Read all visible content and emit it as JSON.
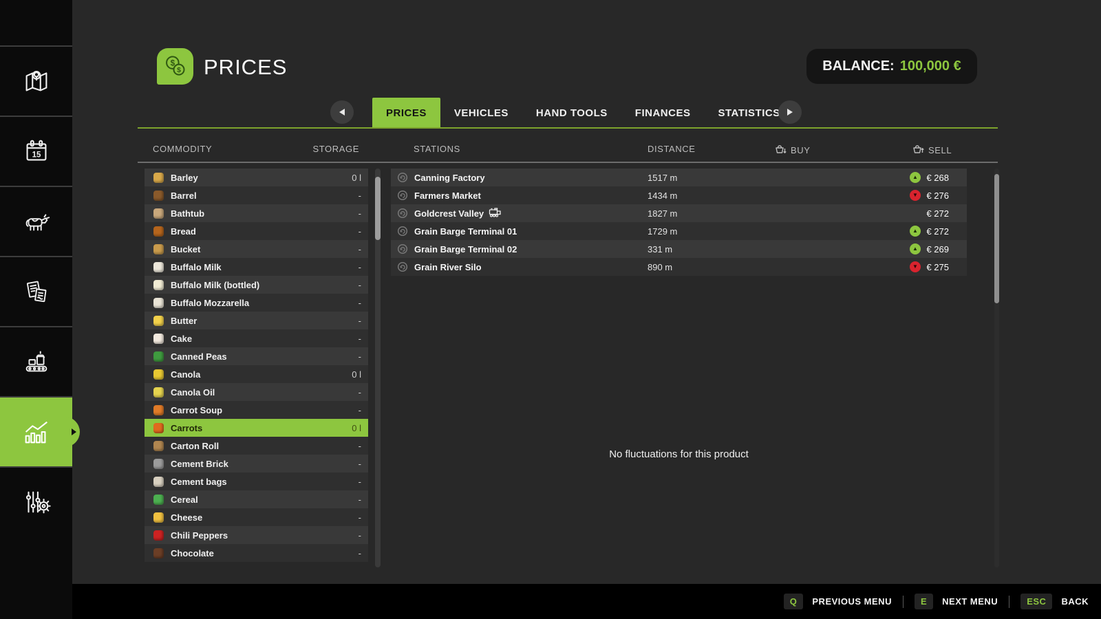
{
  "header": {
    "title": "PRICES",
    "balance_label": "BALANCE:",
    "balance_value": "100,000 €"
  },
  "tabs": {
    "items": [
      "PRICES",
      "VEHICLES",
      "HAND TOOLS",
      "FINANCES",
      "STATISTICS"
    ],
    "selected": "PRICES"
  },
  "columns": {
    "commodity": "COMMODITY",
    "storage": "STORAGE",
    "stations": "STATIONS",
    "distance": "DISTANCE",
    "buy": "BUY",
    "sell": "SELL"
  },
  "sidebar": {
    "items": [
      "map",
      "calendar",
      "animals",
      "contracts",
      "production",
      "statistics",
      "settings"
    ],
    "selected": "statistics"
  },
  "commodities": [
    {
      "name": "Barley",
      "storage": "0 l",
      "icon": "barley-icon",
      "color": "#D9A94A"
    },
    {
      "name": "Barrel",
      "storage": "-",
      "icon": "barrel-icon",
      "color": "#8A5A2B"
    },
    {
      "name": "Bathtub",
      "storage": "-",
      "icon": "bathtub-icon",
      "color": "#C9A87C"
    },
    {
      "name": "Bread",
      "storage": "-",
      "icon": "bread-icon",
      "color": "#B5651D"
    },
    {
      "name": "Bucket",
      "storage": "-",
      "icon": "bucket-icon",
      "color": "#C99B4C"
    },
    {
      "name": "Buffalo Milk",
      "storage": "-",
      "icon": "buffalo-milk-icon",
      "color": "#EDE8DB"
    },
    {
      "name": "Buffalo Milk (bottled)",
      "storage": "-",
      "icon": "buffalo-milk-bottled-icon",
      "color": "#F2EDD5"
    },
    {
      "name": "Buffalo Mozzarella",
      "storage": "-",
      "icon": "buffalo-mozzarella-icon",
      "color": "#E9E4D6"
    },
    {
      "name": "Butter",
      "storage": "-",
      "icon": "butter-icon",
      "color": "#F2D14B"
    },
    {
      "name": "Cake",
      "storage": "-",
      "icon": "cake-icon",
      "color": "#F3EADF"
    },
    {
      "name": "Canned Peas",
      "storage": "-",
      "icon": "canned-peas-icon",
      "color": "#3F9B3F"
    },
    {
      "name": "Canola",
      "storage": "0 l",
      "icon": "canola-icon",
      "color": "#E8C832"
    },
    {
      "name": "Canola Oil",
      "storage": "-",
      "icon": "canola-oil-icon",
      "color": "#E6D44F"
    },
    {
      "name": "Carrot Soup",
      "storage": "-",
      "icon": "carrot-soup-icon",
      "color": "#E07B28"
    },
    {
      "name": "Carrots",
      "storage": "0 l",
      "icon": "carrots-icon",
      "color": "#E06A1E",
      "selected": true
    },
    {
      "name": "Carton Roll",
      "storage": "-",
      "icon": "carton-roll-icon",
      "color": "#B08650"
    },
    {
      "name": "Cement Brick",
      "storage": "-",
      "icon": "cement-brick-icon",
      "color": "#9C9C9C"
    },
    {
      "name": "Cement bags",
      "storage": "-",
      "icon": "cement-bags-icon",
      "color": "#D8D0C0"
    },
    {
      "name": "Cereal",
      "storage": "-",
      "icon": "cereal-icon",
      "color": "#4CAF50"
    },
    {
      "name": "Cheese",
      "storage": "-",
      "icon": "cheese-icon",
      "color": "#F0C040"
    },
    {
      "name": "Chili Peppers",
      "storage": "-",
      "icon": "chili-peppers-icon",
      "color": "#CC2222"
    },
    {
      "name": "Chocolate",
      "storage": "-",
      "icon": "chocolate-icon",
      "color": "#6B3E26"
    }
  ],
  "stations": [
    {
      "name": "Canning Factory",
      "distance": "1517 m",
      "trend": "up",
      "price": "€ 268"
    },
    {
      "name": "Farmers Market",
      "distance": "1434 m",
      "trend": "down",
      "price": "€ 276"
    },
    {
      "name": "Goldcrest Valley",
      "distance": "1827 m",
      "trend": "none",
      "price": "€ 272",
      "train": true
    },
    {
      "name": "Grain Barge Terminal 01",
      "distance": "1729 m",
      "trend": "up",
      "price": "€ 272"
    },
    {
      "name": "Grain Barge Terminal 02",
      "distance": "331 m",
      "trend": "up",
      "price": "€ 269"
    },
    {
      "name": "Grain River Silo",
      "distance": "890 m",
      "trend": "down",
      "price": "€ 275"
    }
  ],
  "fluctuations_message": "No fluctuations for this product",
  "footer": {
    "items": [
      {
        "key": "Q",
        "label": "PREVIOUS MENU"
      },
      {
        "key": "E",
        "label": "NEXT MENU"
      },
      {
        "key": "ESC",
        "label": "BACK"
      }
    ]
  },
  "colors": {
    "accent": "#8DC63F",
    "red": "#D9232E",
    "background": "#282828",
    "sidebar": "#0B0B0B"
  }
}
